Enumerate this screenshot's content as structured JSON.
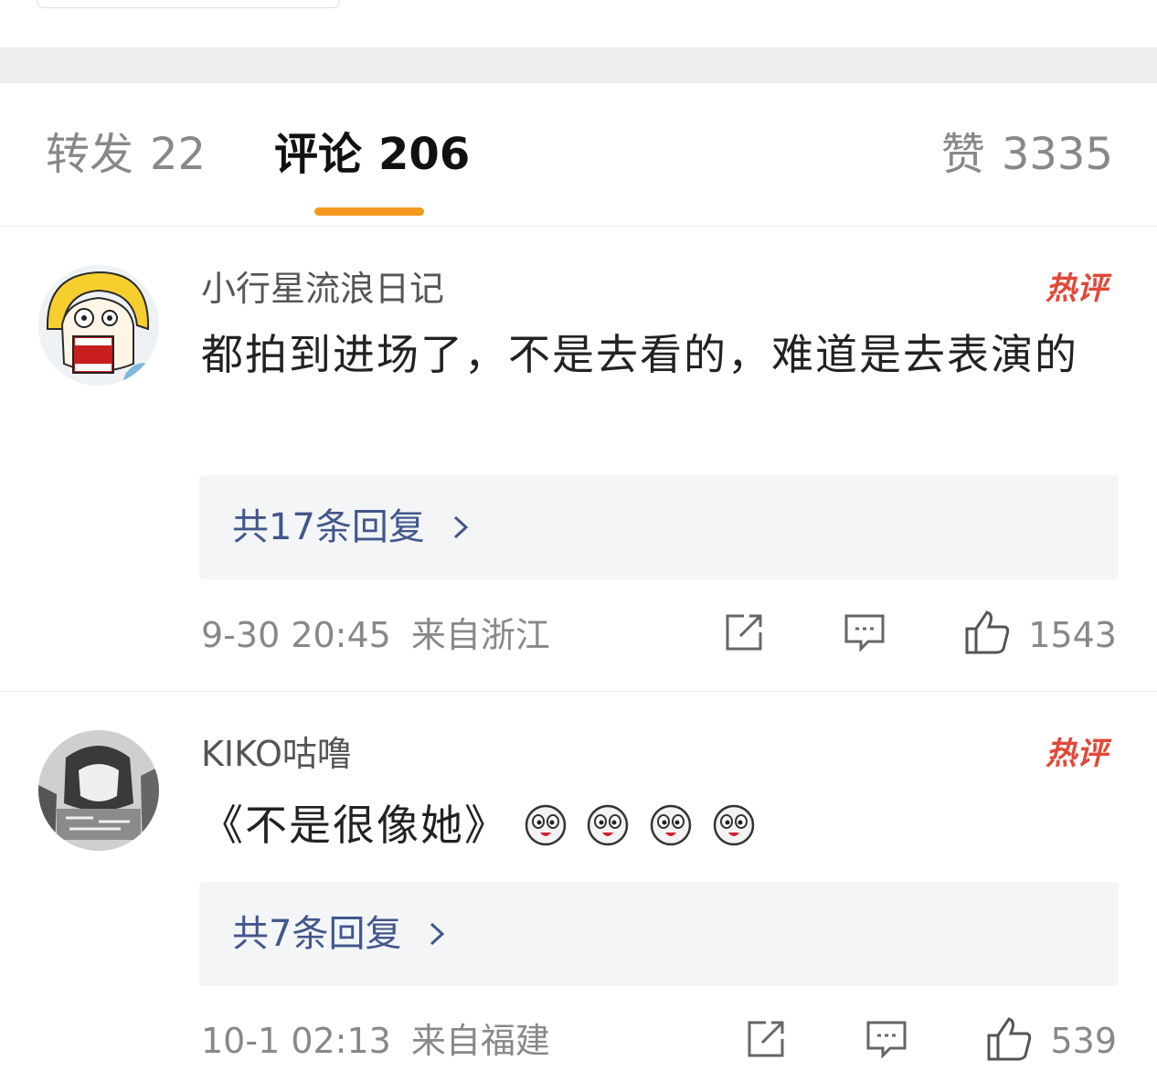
{
  "tabs": {
    "repost": {
      "label": "转发",
      "count": "22"
    },
    "comments": {
      "label": "评论",
      "count": "206"
    },
    "likes": {
      "label": "赞",
      "count": "3335"
    }
  },
  "accent_color": "#f39a1f",
  "comments": [
    {
      "username": "小行星流浪日记",
      "badge": "热评",
      "text": "都拍到进场了，不是去看的，难道是去表演的",
      "replies": "共17条回复",
      "time": "9-30 20:45",
      "location": "来自浙江",
      "likes": "1543"
    },
    {
      "username": "KIKO咕噜",
      "badge": "热评",
      "text": "《不是很像她》",
      "emoji_count": 4,
      "replies": "共7条回复",
      "time": "10-1 02:13",
      "location": "来自福建",
      "likes": "539"
    }
  ],
  "icons": [
    "share-icon",
    "comment-icon",
    "like-icon",
    "chevron-right-icon"
  ]
}
